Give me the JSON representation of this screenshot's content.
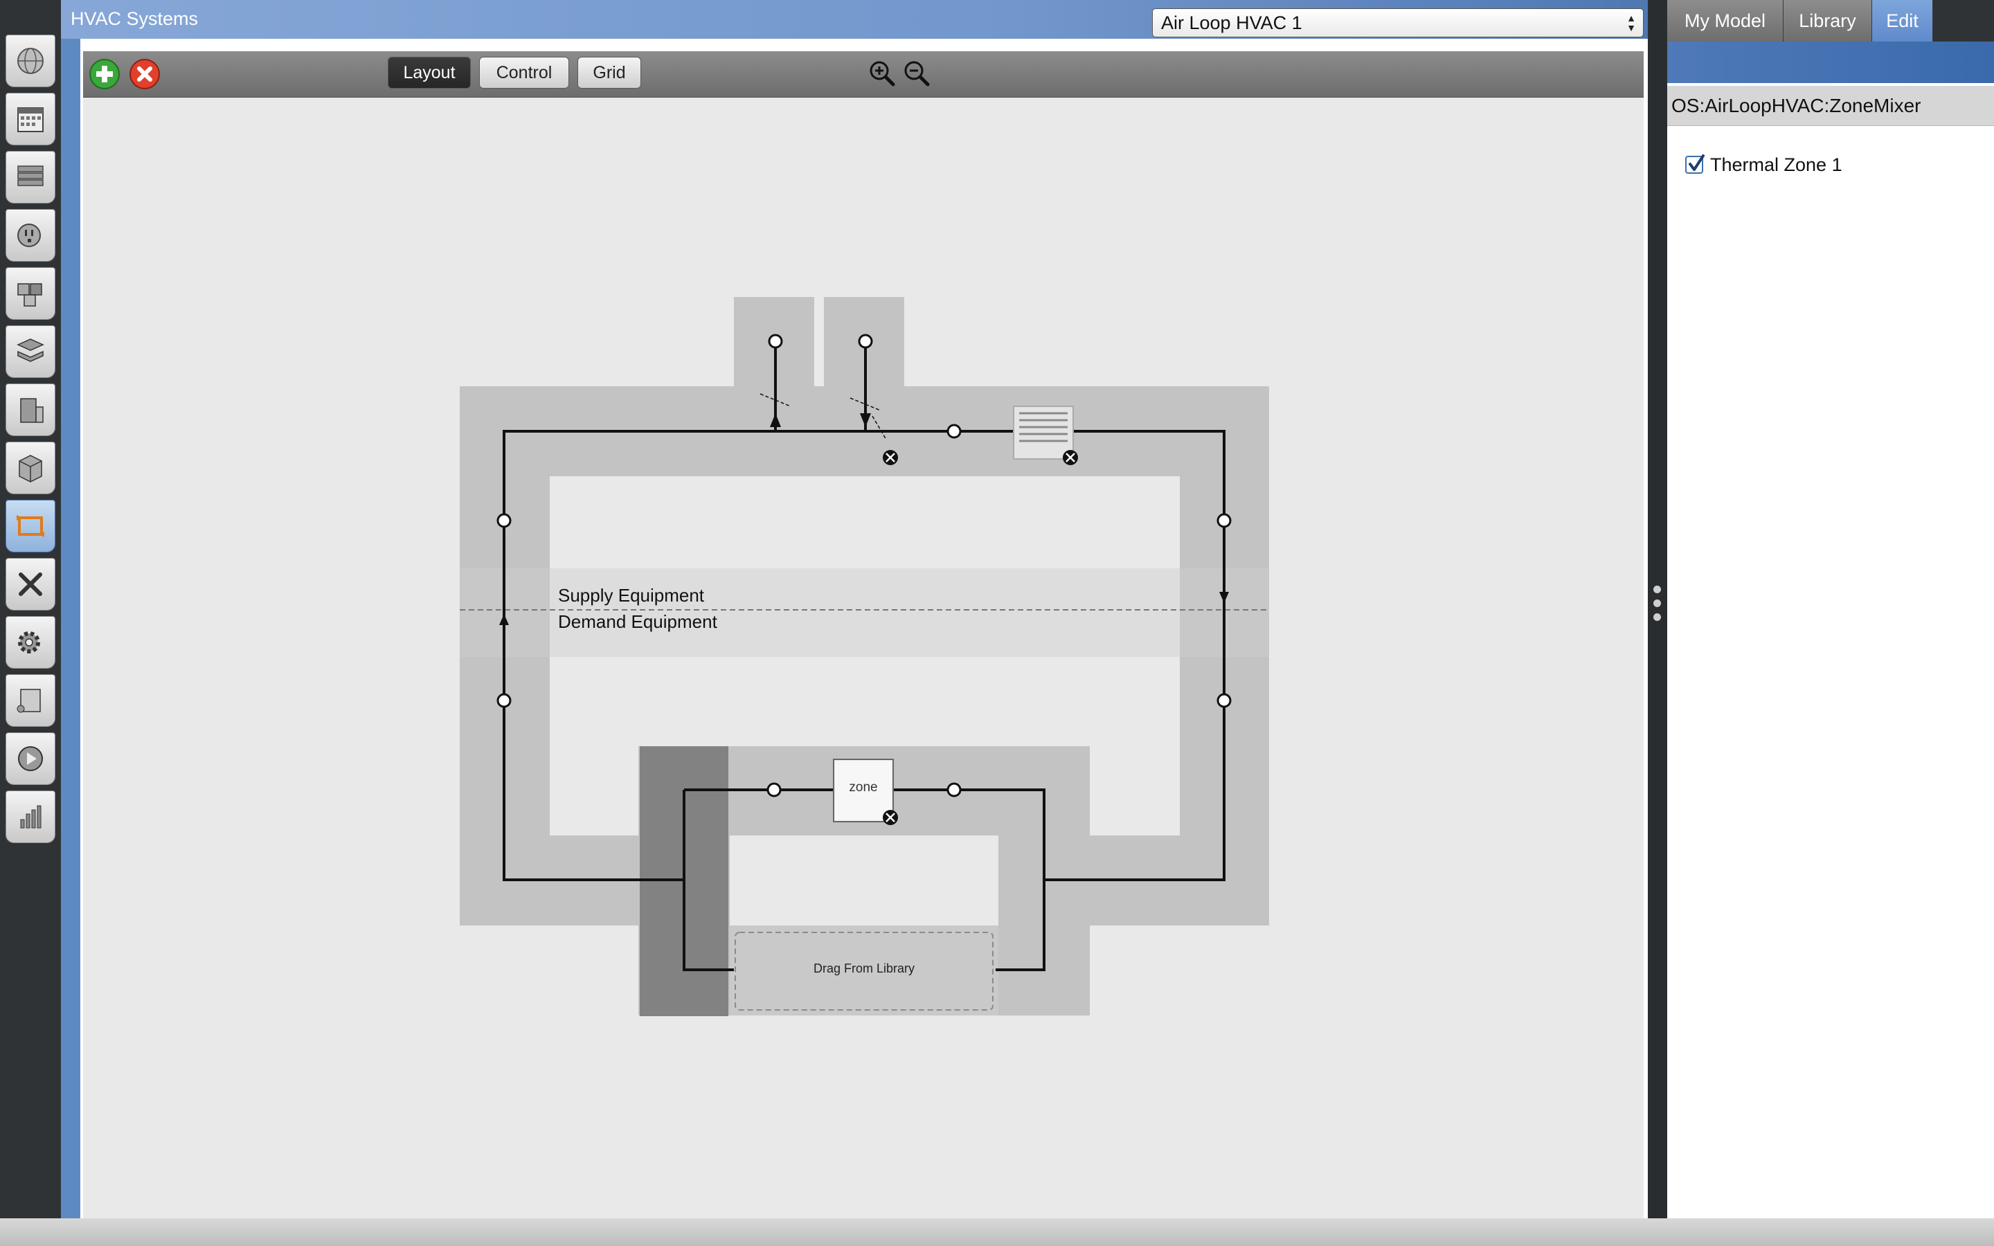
{
  "window": {
    "title": "HVAC Systems"
  },
  "left_toolbar": {
    "items": [
      {
        "name": "site",
        "icon": "globe-icon"
      },
      {
        "name": "schedules",
        "icon": "calendar-icon"
      },
      {
        "name": "constructions",
        "icon": "layers-icon"
      },
      {
        "name": "loads",
        "icon": "plug-icon"
      },
      {
        "name": "space-types",
        "icon": "cubes-icon"
      },
      {
        "name": "geometry",
        "icon": "stack-icon"
      },
      {
        "name": "facility",
        "icon": "building-icon"
      },
      {
        "name": "spaces",
        "icon": "box-icon"
      },
      {
        "name": "hvac-systems",
        "icon": "loop-arrows-icon",
        "active": true
      },
      {
        "name": "building-summary",
        "icon": "tools-icon"
      },
      {
        "name": "simulation-settings",
        "icon": "gear-icon"
      },
      {
        "name": "scripts",
        "icon": "scroll-icon"
      },
      {
        "name": "run",
        "icon": "play-icon"
      },
      {
        "name": "results",
        "icon": "chart-icon"
      }
    ]
  },
  "toolbar": {
    "add_icon": "plus-icon",
    "remove_icon": "close-icon",
    "layout_label": "Layout",
    "control_label": "Control",
    "grid_label": "Grid",
    "zoom_in_icon": "zoom-in-icon",
    "zoom_out_icon": "zoom-out-icon",
    "loop_selected": "Air Loop HVAC 1"
  },
  "diagram": {
    "supply_label": "Supply Equipment",
    "demand_label": "Demand Equipment",
    "zone_label": "zone",
    "drop_label": "Drag From Library"
  },
  "right_panel": {
    "tabs": [
      {
        "label": "My Model",
        "active": false
      },
      {
        "label": "Library",
        "active": false
      },
      {
        "label": "Edit",
        "active": true
      }
    ],
    "component_type": "OS:AirLoopHVAC:ZoneMixer",
    "zones": [
      {
        "label": "Thermal Zone 1",
        "checked": true
      }
    ]
  },
  "colors": {
    "accent_blue": "#5d8ac3",
    "tab_active": "#6f97d2",
    "canvas_bg": "#e9e9e9",
    "loop_band": "#c3c3c3",
    "mixer_band": "#828282"
  }
}
